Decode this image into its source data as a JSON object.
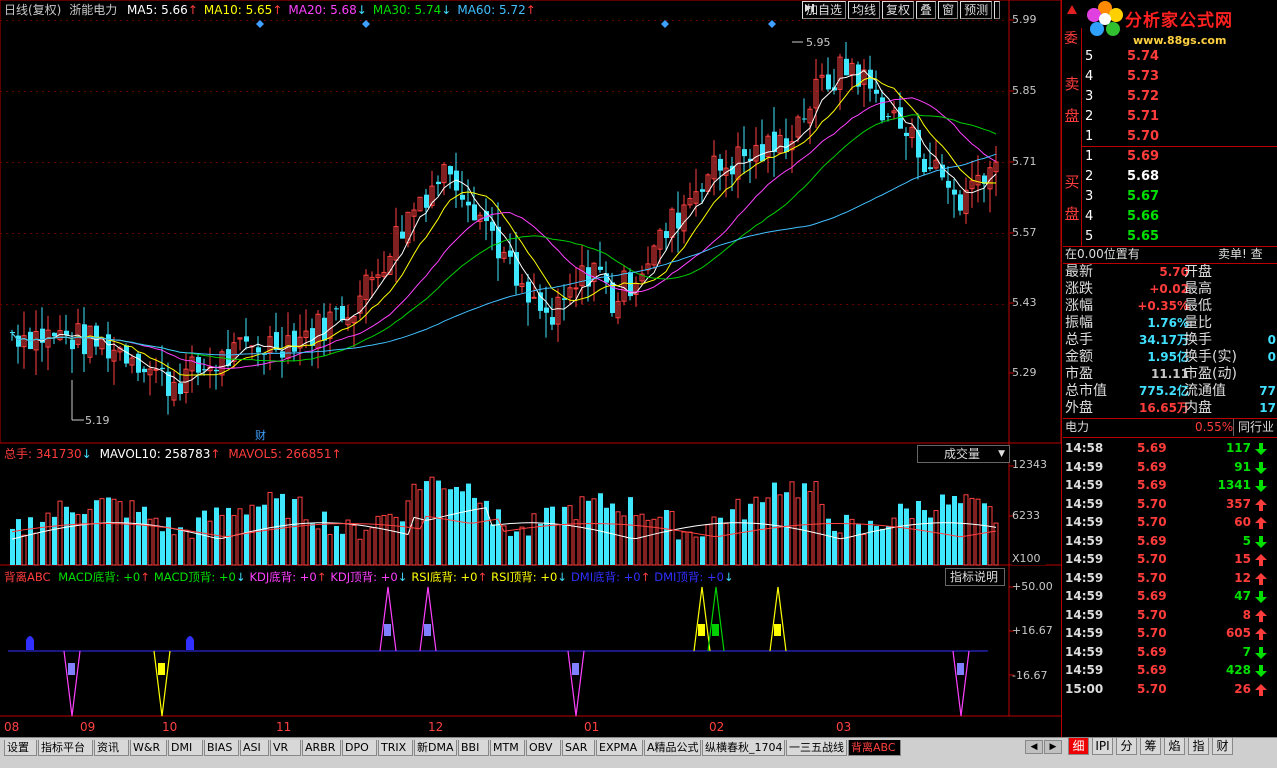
{
  "chart_header": {
    "title": "日线(复权)",
    "stock_name": "浙能电力",
    "ma": [
      {
        "label": "MA5: 5.66",
        "arrow": "↑",
        "color": "#ffffff"
      },
      {
        "label": "MA10: 5.65",
        "arrow": "↑",
        "color": "#ffff00"
      },
      {
        "label": "MA20: 5.68",
        "arrow": "↓",
        "color": "#ff40ff"
      },
      {
        "label": "MA30: 5.74",
        "arrow": "↓",
        "color": "#00e000"
      },
      {
        "label": "MA60: 5.72",
        "arrow": "↑",
        "color": "#40c0ff"
      }
    ]
  },
  "toolbar": {
    "buttons": [
      "加自选",
      "均线",
      "复权",
      "叠",
      "窗",
      "预测"
    ]
  },
  "price_axis": [
    "5.99",
    "5.85",
    "5.71",
    "5.57",
    "5.43",
    "5.29"
  ],
  "price_marks": {
    "high": "5.95",
    "low": "5.19",
    "cai": "财"
  },
  "volume": {
    "total_label": "总手: 341730",
    "total_arrow": "↓",
    "mavol10": "MAVOL10: 258783",
    "mavol10_arrow": "↑",
    "mavol5": "MAVOL5: 266851",
    "mavol5_arrow": "↑",
    "dropdown": "成交量",
    "axis": [
      "12343",
      "6233"
    ],
    "unit": "X100"
  },
  "indicator": {
    "title": "背离ABC",
    "items": [
      {
        "label": "MACD底背: +0",
        "arrow": "↑",
        "color": "#00e000"
      },
      {
        "label": "MACD顶背: +0",
        "arrow": "↓",
        "color": "#00e000"
      },
      {
        "label": "KDJ底背: +0",
        "arrow": "↑",
        "color": "#ff40ff"
      },
      {
        "label": "KDJ顶背: +0",
        "arrow": "↓",
        "color": "#ff40ff"
      },
      {
        "label": "RSI底背: +0",
        "arrow": "↑",
        "color": "#ffff00"
      },
      {
        "label": "RSI顶背: +0",
        "arrow": "↓",
        "color": "#ffff00"
      },
      {
        "label": "DMI底背: +0",
        "arrow": "↑",
        "color": "#3030ff"
      },
      {
        "label": "DMI顶背: +0",
        "arrow": "↓",
        "color": "#3030ff"
      }
    ],
    "explain_button": "指标说明",
    "axis": [
      "+50.00",
      "+16.67",
      "-16.67"
    ]
  },
  "months": [
    "08",
    "09",
    "10",
    "11",
    "12",
    "01",
    "02",
    "03"
  ],
  "logo": {
    "text": "分析家公式网",
    "url": "www.88gs.com"
  },
  "orderbook": {
    "wei": "委",
    "sell_label": [
      "卖",
      "盘"
    ],
    "buy_label": [
      "买",
      "盘"
    ],
    "sell": [
      {
        "level": "5",
        "price": "5.74"
      },
      {
        "level": "4",
        "price": "5.73"
      },
      {
        "level": "3",
        "price": "5.72"
      },
      {
        "level": "2",
        "price": "5.71"
      },
      {
        "level": "1",
        "price": "5.70"
      }
    ],
    "buy": [
      {
        "level": "1",
        "price": "5.69",
        "color": "#ff3c3c"
      },
      {
        "level": "2",
        "price": "5.68",
        "color": "#ffffff"
      },
      {
        "level": "3",
        "price": "5.67",
        "color": "#00e000"
      },
      {
        "level": "4",
        "price": "5.66",
        "color": "#00e000"
      },
      {
        "level": "5",
        "price": "5.65",
        "color": "#00e000"
      }
    ]
  },
  "position_bar": {
    "left": "在0.00位置有",
    "right": "卖单! 查"
  },
  "quote": [
    {
      "l": "最新",
      "v": "5.70",
      "vc": "#ff3c3c",
      "r": "开盘"
    },
    {
      "l": "涨跌",
      "v": "+0.02",
      "vc": "#ff3c3c",
      "r": "最高"
    },
    {
      "l": "涨幅",
      "v": "+0.35%",
      "vc": "#ff3c3c",
      "r": "最低"
    },
    {
      "l": "振幅",
      "v": "1.76%",
      "vc": "#40e0ff",
      "r": "量比"
    },
    {
      "l": "总手",
      "v": "34.17万",
      "vc": "#40e0ff",
      "r": "换手"
    },
    {
      "l": "金额",
      "v": "1.95亿",
      "vc": "#40e0ff",
      "r": "换手(实)"
    },
    {
      "l": "市盈",
      "v": "11.11",
      "vc": "#c8c8c8",
      "r": "市盈(动)"
    },
    {
      "l": "总市值",
      "v": "775.2亿",
      "vc": "#40e0ff",
      "r": "流通值"
    },
    {
      "l": "外盘",
      "v": "16.65万",
      "vc": "#ff3c3c",
      "r": "内盘"
    }
  ],
  "quote_right_values": [
    "0",
    "0",
    "77",
    "17"
  ],
  "industry": {
    "name": "电力",
    "pct": "0.55%",
    "button": "同行业"
  },
  "ticks": [
    {
      "t": "14:58",
      "p": "5.69",
      "v": "117",
      "dir": "down"
    },
    {
      "t": "14:59",
      "p": "5.69",
      "v": "91",
      "dir": "down"
    },
    {
      "t": "14:59",
      "p": "5.69",
      "v": "1341",
      "dir": "down"
    },
    {
      "t": "14:59",
      "p": "5.70",
      "v": "357",
      "dir": "up"
    },
    {
      "t": "14:59",
      "p": "5.70",
      "v": "60",
      "dir": "up"
    },
    {
      "t": "14:59",
      "p": "5.69",
      "v": "5",
      "dir": "down"
    },
    {
      "t": "14:59",
      "p": "5.70",
      "v": "15",
      "dir": "up"
    },
    {
      "t": "14:59",
      "p": "5.70",
      "v": "12",
      "dir": "up"
    },
    {
      "t": "14:59",
      "p": "5.69",
      "v": "47",
      "dir": "down"
    },
    {
      "t": "14:59",
      "p": "5.70",
      "v": "8",
      "dir": "up"
    },
    {
      "t": "14:59",
      "p": "5.70",
      "v": "605",
      "dir": "up"
    },
    {
      "t": "14:59",
      "p": "5.69",
      "v": "7",
      "dir": "down"
    },
    {
      "t": "14:59",
      "p": "5.69",
      "v": "428",
      "dir": "down"
    },
    {
      "t": "15:00",
      "p": "5.70",
      "v": "26",
      "dir": "up"
    }
  ],
  "bottom_tabs": [
    "设置",
    "指标平台",
    "资讯",
    "W&R",
    "DMI",
    "BIAS",
    "ASI",
    "VR",
    "ARBR",
    "DPO",
    "TRIX",
    "新DMA",
    "BBI",
    "MTM",
    "OBV",
    "SAR",
    "EXPMA",
    "A精品公式",
    "纵横春秋_1704",
    "一三五战线",
    "背离ABC"
  ],
  "right_tabs": [
    "细",
    "IPI",
    "分",
    "筹",
    "焰",
    "指",
    "财"
  ]
}
